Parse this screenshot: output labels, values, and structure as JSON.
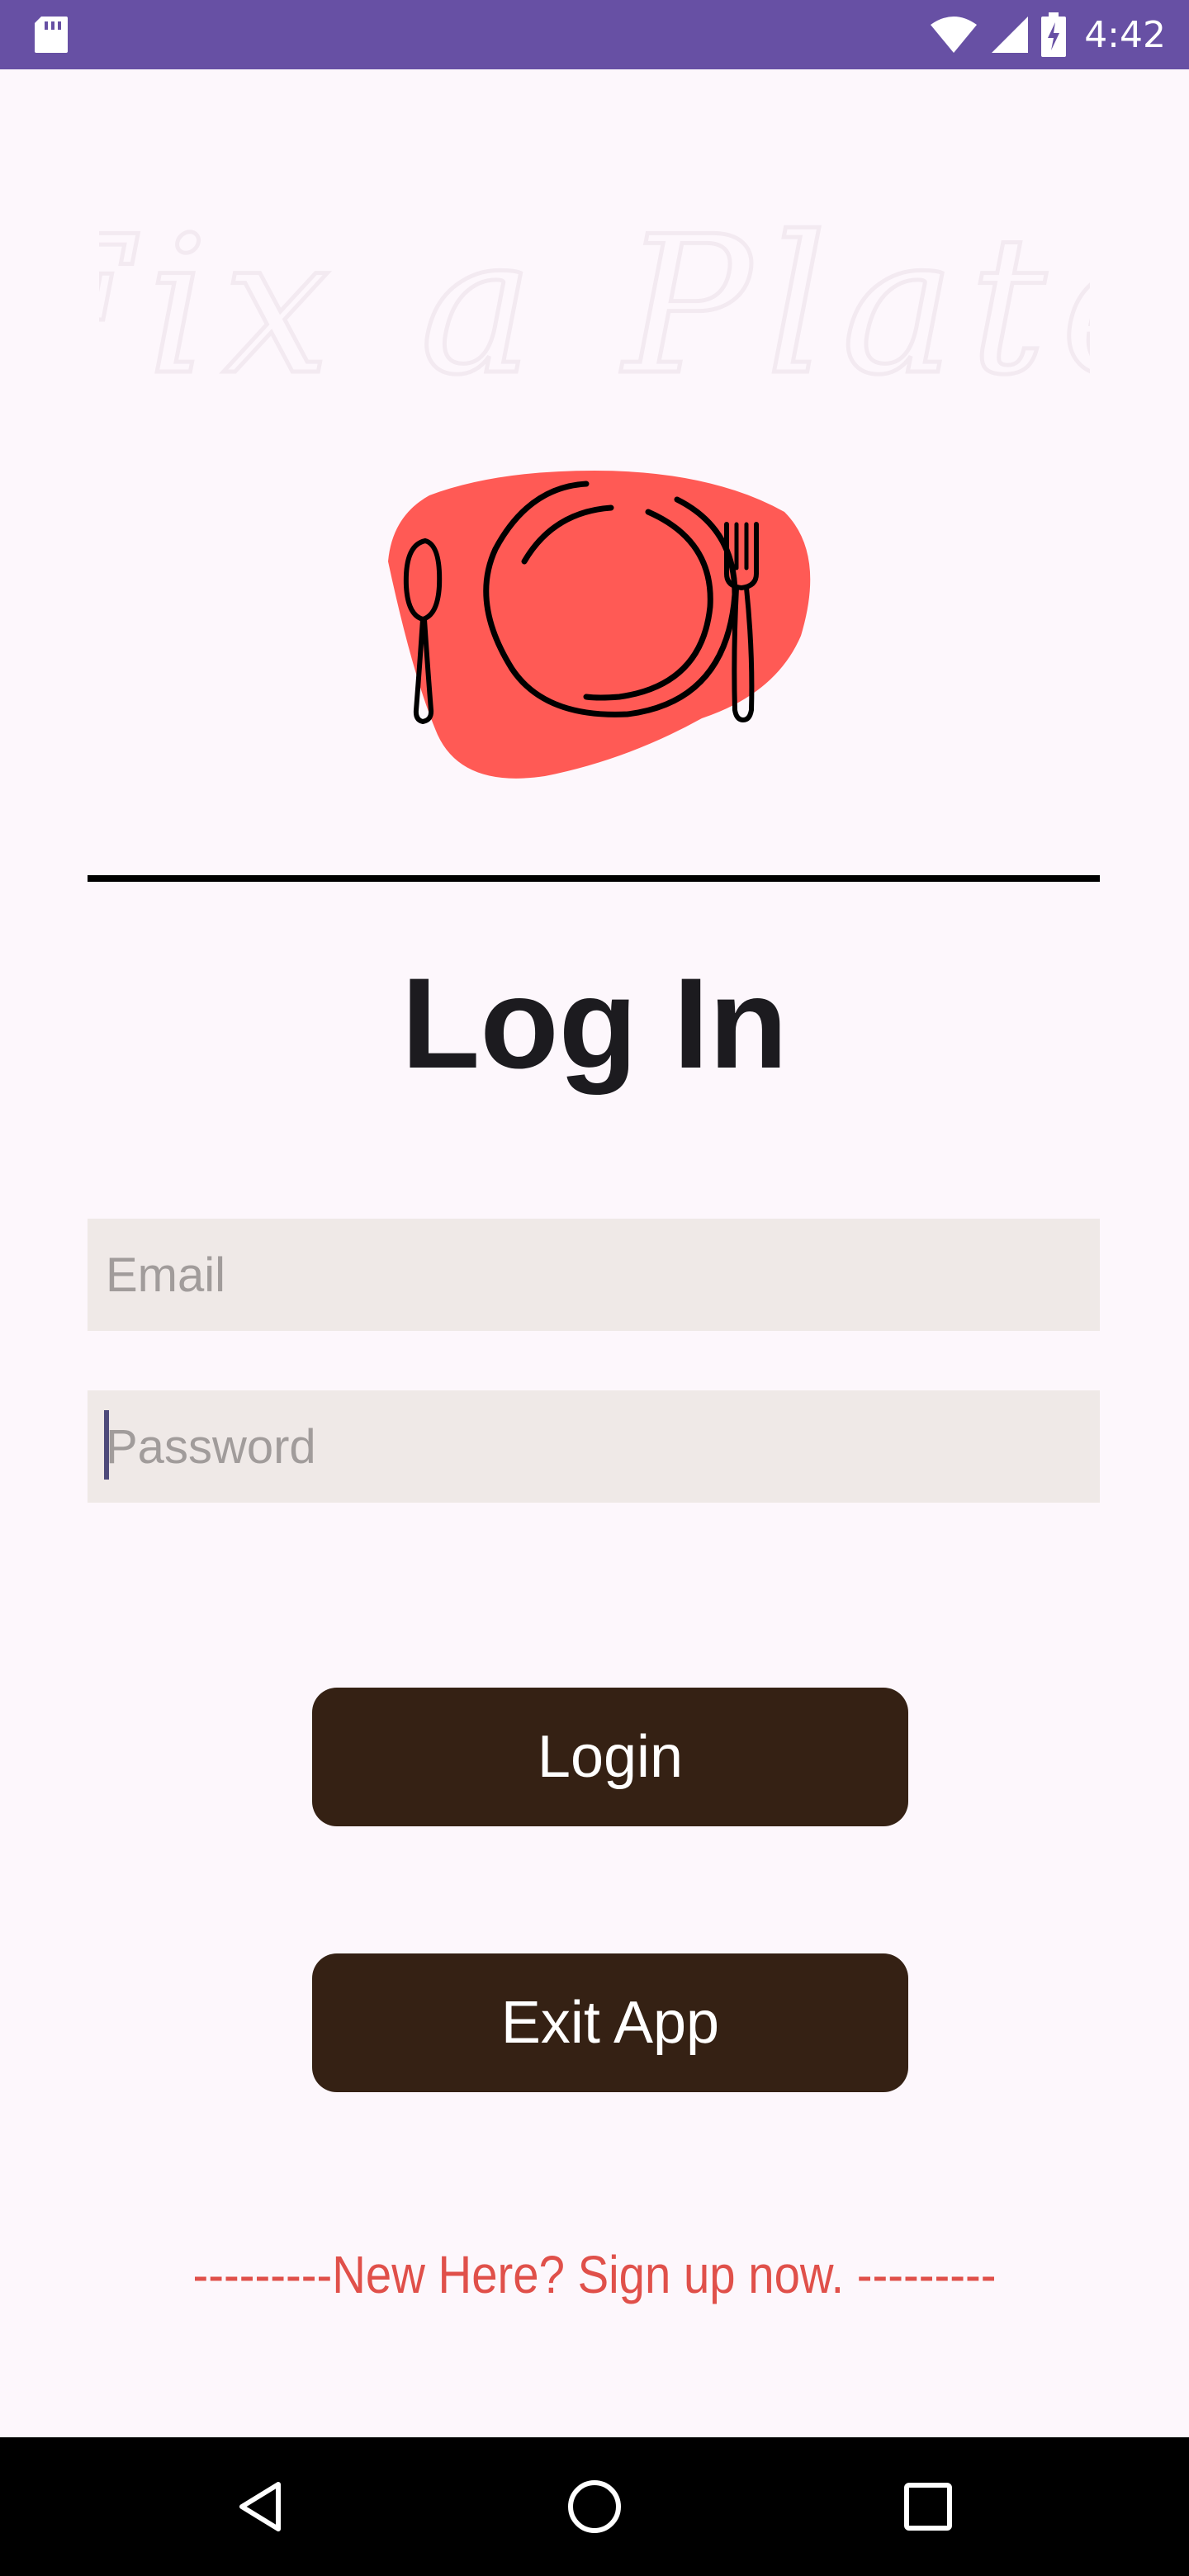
{
  "status_bar": {
    "time": "4:42",
    "background": "#6750a4",
    "icons": [
      "sd-card-icon",
      "wifi-icon",
      "cell-signal-icon",
      "battery-charging-icon"
    ]
  },
  "app": {
    "brand_title": "Fix a Plate",
    "logo_icon": "plate-fork-spoon-logo",
    "logo_color": "#ff5a55"
  },
  "login": {
    "title": "Log In",
    "email_placeholder": "Email",
    "email_value": "",
    "password_placeholder": "Password",
    "password_value": "",
    "login_button_label": "Login",
    "exit_button_label": "Exit App",
    "signup_link_text": "---------New Here? Sign up now. ---------"
  },
  "colors": {
    "background": "#fdf7fc",
    "button": "#352114",
    "field_bg": "#efe9e7",
    "link": "#e0504a"
  },
  "nav_bar": {
    "icons": [
      "back-icon",
      "home-icon",
      "recents-icon"
    ]
  }
}
